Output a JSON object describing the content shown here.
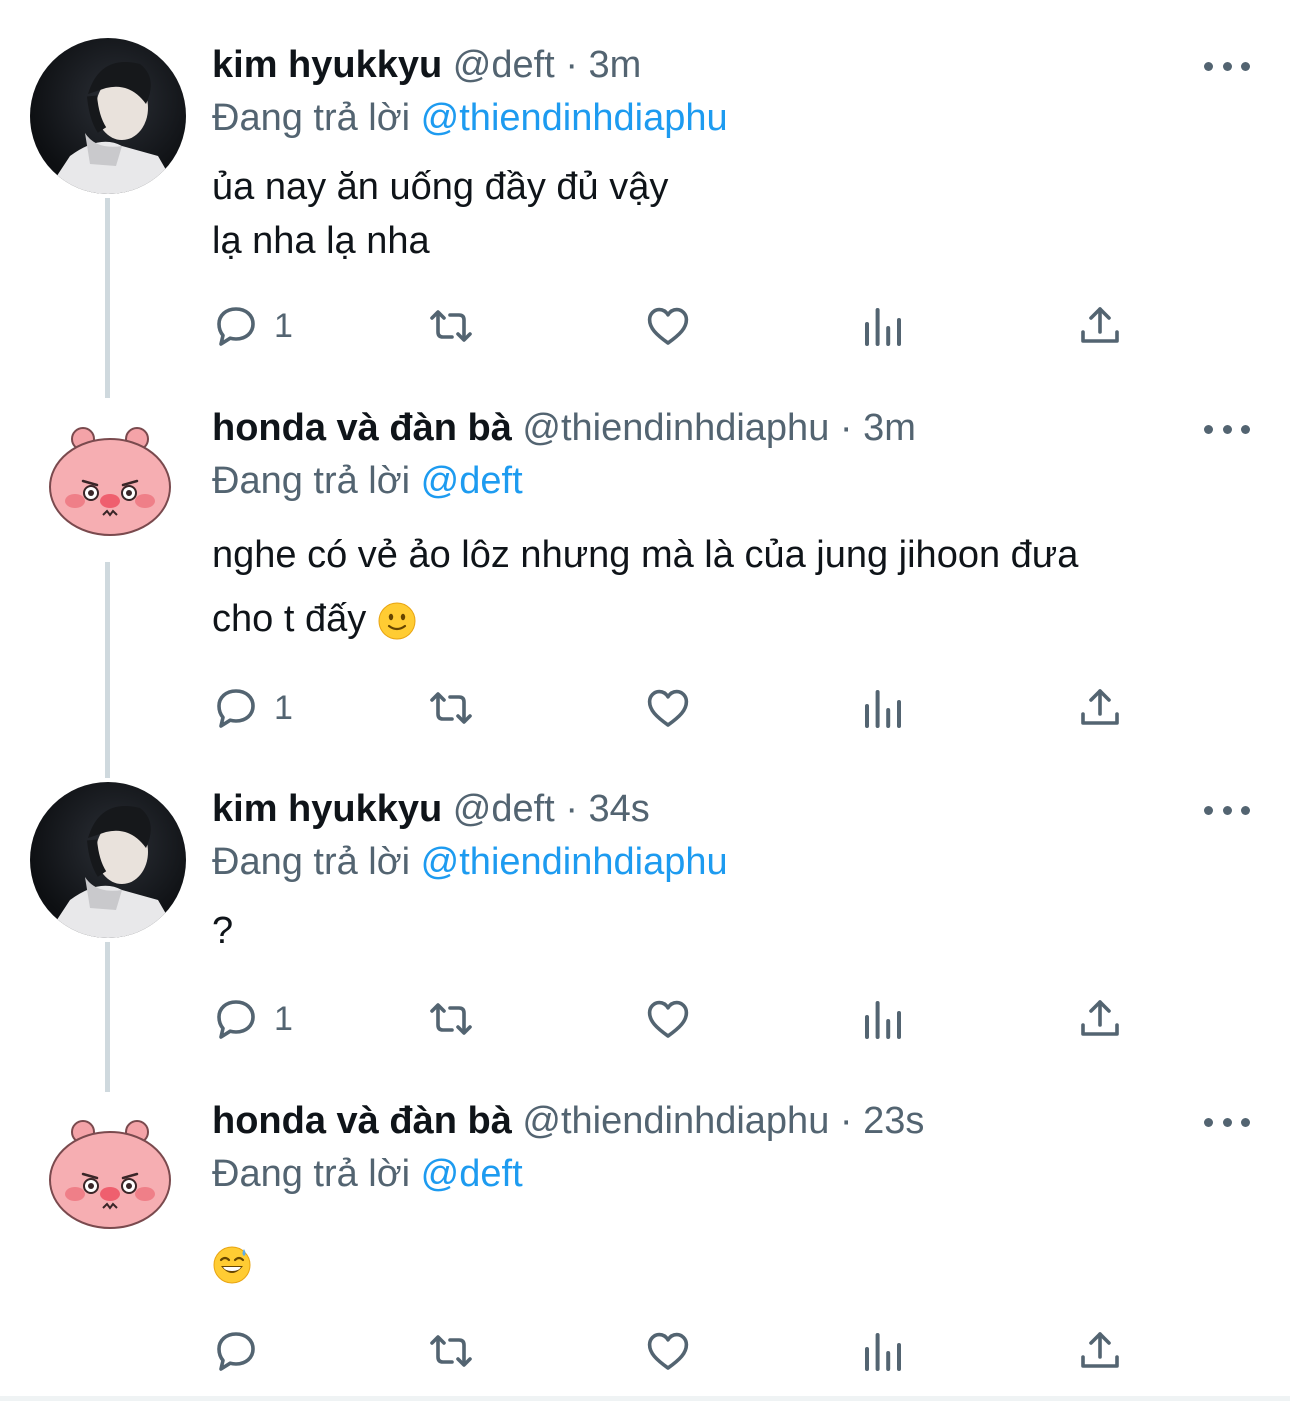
{
  "tweets": [
    {
      "name": "kim hyukkyu",
      "handle": "@deft",
      "time": "3m",
      "reply_prefix": "Đang trả lời",
      "reply_to": "@thiendinhdiaphu",
      "lines": [
        "ủa nay ăn uống đầy đủ vậy",
        "lạ nha lạ nha"
      ],
      "reply_count": "1",
      "avatar": "photo"
    },
    {
      "name": "honda và đàn bà",
      "handle": "@thiendinhdiaphu",
      "time": "3m",
      "reply_prefix": "Đang trả lời",
      "reply_to": "@deft",
      "lines": [
        "nghe có vẻ ảo lôz nhưng mà là của jung jihoon đưa",
        "cho t đấy"
      ],
      "emoji": "slightly-smiling-face",
      "reply_count": "1",
      "avatar": "pink-pig"
    },
    {
      "name": "kim hyukkyu",
      "handle": "@deft",
      "time": "34s",
      "reply_prefix": "Đang trả lời",
      "reply_to": "@thiendinhdiaphu",
      "lines": [
        "?"
      ],
      "reply_count": "1",
      "avatar": "photo"
    },
    {
      "name": "honda và đàn bà",
      "handle": "@thiendinhdiaphu",
      "time": "23s",
      "reply_prefix": "Đang trả lời",
      "reply_to": "@deft",
      "emoji": "grinning-face-with-sweat",
      "reply_count": "",
      "avatar": "pink-pig"
    }
  ],
  "separator": "·",
  "icons": [
    "more-icon",
    "reply-icon",
    "retweet-icon",
    "like-icon",
    "analytics-icon",
    "share-icon"
  ],
  "colors": {
    "mention": "#1d9bf0",
    "secondary": "#536471",
    "thread_line": "#cfd9de"
  }
}
